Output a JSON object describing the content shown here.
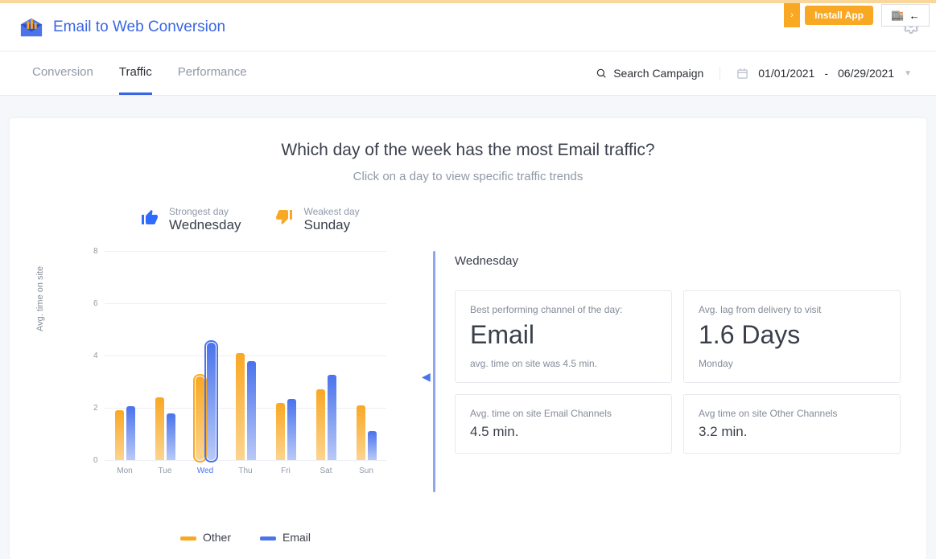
{
  "install": {
    "label": "Install App"
  },
  "brand": {
    "title": "Email to Web Conversion"
  },
  "tabs": {
    "conversion": "Conversion",
    "traffic": "Traffic",
    "performance": "Performance"
  },
  "search": {
    "placeholder": "Search Campaign"
  },
  "date": {
    "from": "01/01/2021",
    "sep": "-",
    "to": "06/29/2021"
  },
  "headline": "Which day of the week has the most Email traffic?",
  "subtext": "Click on a day to view specific traffic trends",
  "strongest": {
    "label": "Strongest day",
    "value": "Wednesday"
  },
  "weakest": {
    "label": "Weakest day",
    "value": "Sunday"
  },
  "ylabel": "Avg. time on site",
  "xticks": {
    "mon": "Mon",
    "tue": "Tue",
    "wed": "Wed",
    "thu": "Thu",
    "fri": "Fri",
    "sat": "Sat",
    "sun": "Sun"
  },
  "legend": {
    "other": "Other",
    "email": "Email"
  },
  "panel": {
    "title": "Wednesday",
    "box1": {
      "lab": "Best performing channel of the day:",
      "big": "Email",
      "sub": "avg. time on site was 4.5 min."
    },
    "box2": {
      "lab": "Avg. lag from delivery to visit",
      "big": "1.6 Days",
      "sub": "Monday"
    },
    "box3": {
      "lab": "Avg. time on site Email Channels",
      "med": "4.5 min."
    },
    "box4": {
      "lab": "Avg time on site Other Channels",
      "med": "3.2 min."
    }
  },
  "yticks": {
    "y0": "0",
    "y2": "2",
    "y4": "4",
    "y6": "6",
    "y8": "8"
  },
  "chart_data": {
    "type": "bar",
    "title": "Which day of the week has the most Email traffic?",
    "ylabel": "Avg. time on site",
    "xlabel": "",
    "ylim": [
      0,
      8
    ],
    "categories": [
      "Mon",
      "Tue",
      "Wed",
      "Thu",
      "Fri",
      "Sat",
      "Sun"
    ],
    "series": [
      {
        "name": "Other",
        "values": [
          1.9,
          2.4,
          3.2,
          4.1,
          2.2,
          2.7,
          2.1
        ]
      },
      {
        "name": "Email",
        "values": [
          2.05,
          1.8,
          4.5,
          3.8,
          2.35,
          3.25,
          1.1
        ]
      }
    ],
    "selected_category": "Wed",
    "legend_position": "bottom"
  }
}
